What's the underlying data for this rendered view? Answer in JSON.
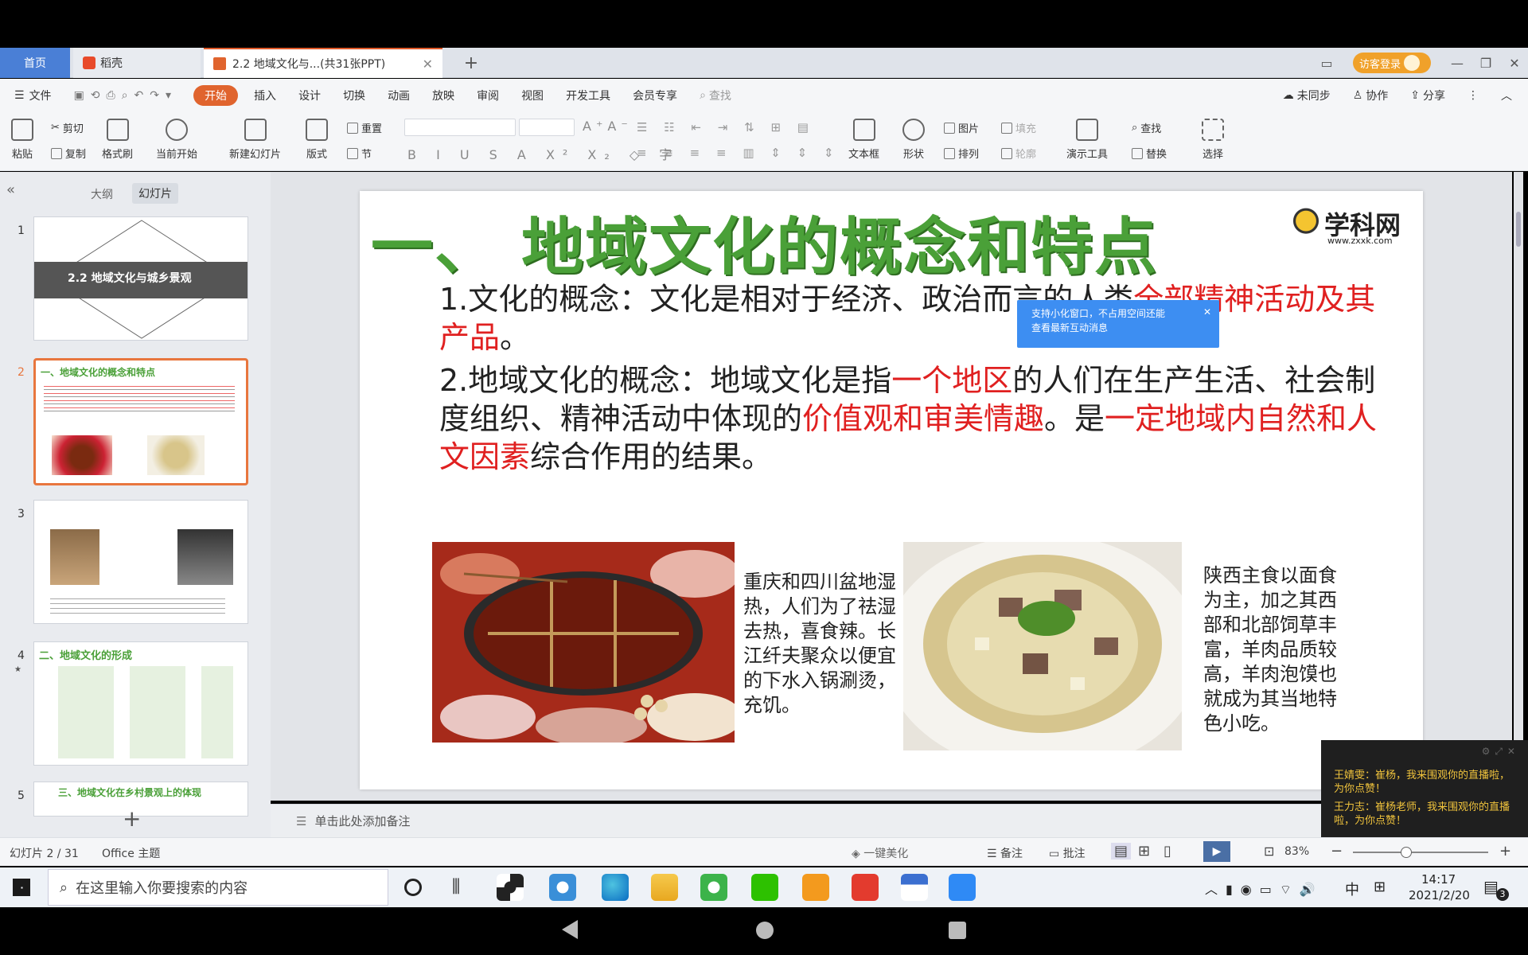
{
  "tabs": {
    "home": "首页",
    "daoke": "稻壳",
    "doc": "2.2 地域文化与...(共31张PPT)",
    "add": "+"
  },
  "titlebar": {
    "visitor_login": "访客登录"
  },
  "menubar": {
    "file": "文件",
    "items": [
      "开始",
      "插入",
      "设计",
      "切换",
      "动画",
      "放映",
      "审阅",
      "视图",
      "开发工具",
      "会员专享"
    ],
    "search": "查找",
    "sync": "未同步",
    "collab": "协作",
    "share": "分享"
  },
  "ribbon": {
    "paste": "粘贴",
    "cut": "剪切",
    "copy": "复制",
    "format_painter": "格式刷",
    "from_current": "当前开始",
    "new_slide": "新建幻灯片",
    "layout": "版式",
    "section": "节",
    "reset": "重置",
    "textbox": "文本框",
    "shape": "形状",
    "picture": "图片",
    "arrange": "排列",
    "fill": "填充",
    "outline": "轮廓",
    "presenter": "演示工具",
    "find": "查找",
    "replace": "替换",
    "select": "选择"
  },
  "leftpane": {
    "outline_tab": "大纲",
    "slides_tab": "幻灯片",
    "slide_numbers": [
      "1",
      "2",
      "3",
      "4",
      "5"
    ],
    "thumb1_title": "2.2   地域文化与城乡景观",
    "thumb2_title": "一、地域文化的概念和特点",
    "thumb4_title": "二、地域文化的形成",
    "thumb5_title": "三、地域文化在乡村景观上的体现",
    "add_button": "+"
  },
  "slide": {
    "title": "一、 地域文化的概念和特点",
    "logo_text": "学科网",
    "logo_url": "www.zxxk.com",
    "p1_a": "1.文化的概念：文化是相对于经济、政治而言的人类",
    "p1_b": "全部精神活动",
    "p1_c": "及其产品",
    "p1_d": "。",
    "p2_a": "2.地域文化的概念：地域文化是指",
    "p2_b": "一个地区",
    "p2_c": "的人们在生产生活、社会制度组织、精神活动中体现的",
    "p2_d": "价值观和审美情趣",
    "p2_e": "。是",
    "p2_f": "一定地域内自然和人文因素",
    "p2_g": "综合作用的结果。",
    "caption1": "重庆和四川盆地湿热，人们为了祛湿去热，喜食辣。长江纤夫聚众以便宜的下水入锅涮烫，充饥。",
    "caption2": "陕西主食以面食为主，加之其西部和北部饲草丰富，羊肉品质较高，羊肉泡馍也就成为其当地特色小吃。"
  },
  "tip_popup": {
    "line1": "支持小化窗口，不占用空间还能",
    "line2": "查看最新互动消息"
  },
  "chat": {
    "msg1": "王婧雯：崔杨，我来围观你的直播啦，为你点赞！",
    "msg2": "王力志：崔杨老师，我来围观你的直播啦，为你点赞！"
  },
  "notes": {
    "placeholder": "单击此处添加备注"
  },
  "statusbar": {
    "slide_info": "幻灯片 2 / 31",
    "theme": "Office 主题",
    "beautify": "一键美化",
    "notes": "备注",
    "comments": "批注",
    "zoom": "83%"
  },
  "taskbar": {
    "search_placeholder": "在这里输入你要搜索的内容",
    "ime": "中",
    "time": "14:17",
    "date": "2021/2/20",
    "notify_count": "3"
  }
}
